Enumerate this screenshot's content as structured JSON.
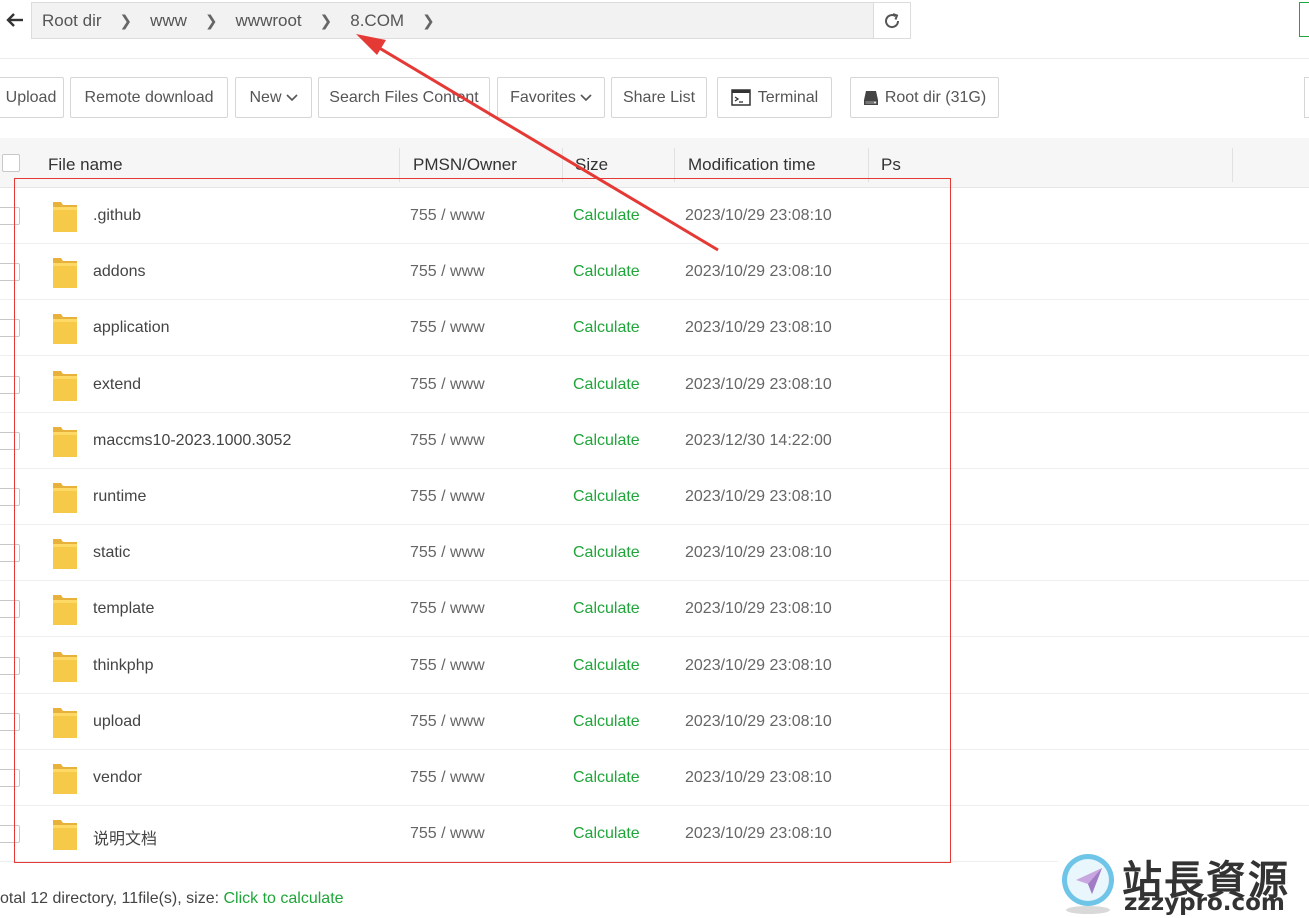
{
  "breadcrumb": {
    "items": [
      {
        "label": "Root dir"
      },
      {
        "label": "www"
      },
      {
        "label": "wwwroot"
      },
      {
        "label": "8.COM"
      }
    ]
  },
  "toolbar": {
    "upload": "Upload",
    "remote_download": "Remote download",
    "new": "New",
    "search": "Search Files Content",
    "favorites": "Favorites",
    "share_list": "Share List",
    "terminal": "Terminal",
    "disk": "Root dir (31G)"
  },
  "table": {
    "headers": {
      "name": "File name",
      "owner": "PMSN/Owner",
      "size": "Size",
      "mtime": "Modification time",
      "ps": "Ps"
    },
    "rows": [
      {
        "name": ".github",
        "perm": "755 / www",
        "size": "Calculate",
        "mtime": "2023/10/29 23:08:10"
      },
      {
        "name": "addons",
        "perm": "755 / www",
        "size": "Calculate",
        "mtime": "2023/10/29 23:08:10"
      },
      {
        "name": "application",
        "perm": "755 / www",
        "size": "Calculate",
        "mtime": "2023/10/29 23:08:10"
      },
      {
        "name": "extend",
        "perm": "755 / www",
        "size": "Calculate",
        "mtime": "2023/10/29 23:08:10"
      },
      {
        "name": "maccms10-2023.1000.3052",
        "perm": "755 / www",
        "size": "Calculate",
        "mtime": "2023/12/30 14:22:00"
      },
      {
        "name": "runtime",
        "perm": "755 / www",
        "size": "Calculate",
        "mtime": "2023/10/29 23:08:10"
      },
      {
        "name": "static",
        "perm": "755 / www",
        "size": "Calculate",
        "mtime": "2023/10/29 23:08:10"
      },
      {
        "name": "template",
        "perm": "755 / www",
        "size": "Calculate",
        "mtime": "2023/10/29 23:08:10"
      },
      {
        "name": "thinkphp",
        "perm": "755 / www",
        "size": "Calculate",
        "mtime": "2023/10/29 23:08:10"
      },
      {
        "name": "upload",
        "perm": "755 / www",
        "size": "Calculate",
        "mtime": "2023/10/29 23:08:10"
      },
      {
        "name": "vendor",
        "perm": "755 / www",
        "size": "Calculate",
        "mtime": "2023/10/29 23:08:10"
      },
      {
        "name": "说明文档",
        "perm": "755 / www",
        "size": "Calculate",
        "mtime": "2023/10/29 23:08:10"
      }
    ]
  },
  "footer": {
    "summary": "otal 12 directory, 11file(s), size: ",
    "calculate_link": "Click to calculate"
  },
  "watermark": {
    "cn": "站長資源",
    "en": "zzzypro.com"
  },
  "colors": {
    "accent_green": "#20a53a",
    "annotation_red": "#e53935",
    "folder_yellow": "#f7c948"
  }
}
